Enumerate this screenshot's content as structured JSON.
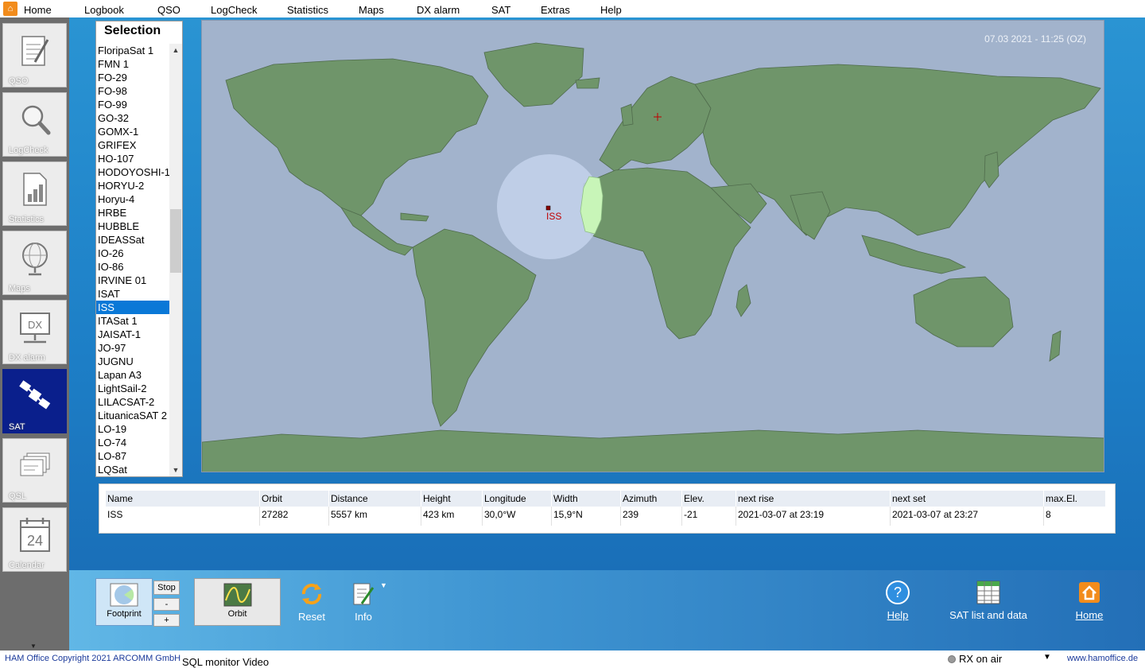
{
  "menu": {
    "items": [
      "Home",
      "Logbook",
      "QSO",
      "LogCheck",
      "Statistics",
      "Maps",
      "DX alarm",
      "SAT",
      "Extras",
      "Help"
    ]
  },
  "sidebar": {
    "items": [
      {
        "label": "QSO",
        "icon": "notepad-icon"
      },
      {
        "label": "LogCheck",
        "icon": "magnifier-icon"
      },
      {
        "label": "Statistics",
        "icon": "chart-document-icon"
      },
      {
        "label": "Maps",
        "icon": "globe-icon"
      },
      {
        "label": "DX alarm",
        "icon": "dx-monitor-icon"
      },
      {
        "label": "SAT",
        "icon": "satellite-icon"
      },
      {
        "label": "QSL",
        "icon": "cards-icon"
      },
      {
        "label": "Calendar",
        "icon": "calendar-icon",
        "day": "24"
      }
    ],
    "active": "SAT"
  },
  "selection": {
    "title": "Selection",
    "items": [
      "FloripaSat 1",
      "FMN 1",
      "FO-29",
      "FO-98",
      "FO-99",
      "GO-32",
      "GOMX-1",
      "GRIFEX",
      "HO-107",
      "HODOYOSHI-1",
      "HORYU-2",
      "Horyu-4",
      "HRBE",
      "HUBBLE",
      "IDEASSat",
      "IO-26",
      "IO-86",
      "IRVINE 01",
      "ISAT",
      "ISS",
      "ITASat 1",
      "JAISAT-1",
      "JO-97",
      "JUGNU",
      "Lapan A3",
      "LightSail-2",
      "LILACSAT-2",
      "LituanicaSAT 2",
      "LO-19",
      "LO-74",
      "LO-87",
      "LQSat"
    ],
    "selected": "ISS"
  },
  "map": {
    "datetime": "07.03 2021 - 11:25 (OZ)",
    "satellite_label": "ISS",
    "ocean_color": "#a2b3cc",
    "land_color": "#6f956a",
    "footprint_color": "#c3d2ea",
    "daylight_color": "#c8f5b8"
  },
  "table": {
    "headers": [
      "Name",
      "Orbit",
      "Distance",
      "Height",
      "Longitude",
      "Width",
      "Azimuth",
      "Elev.",
      "next rise",
      "next set",
      "max.El."
    ],
    "row": [
      "ISS",
      "27282",
      "5557 km",
      "423 km",
      "30,0°W",
      "15,9°N",
      "239",
      "-21",
      "2021-03-07 at 23:19",
      "2021-03-07 at 23:27",
      "8"
    ]
  },
  "toolbar": {
    "footprint_label": "Footprint",
    "stop_label": "Stop",
    "minus_label": "-",
    "plus_label": "+",
    "orbit_label": "Orbit",
    "reset_label": "Reset",
    "info_label": "Info",
    "help_label": "Help",
    "satlist_label": "SAT list and data",
    "home_label": "Home"
  },
  "status": {
    "copyright": "HAM Office Copyright 2021 ARCOMM GmbH",
    "tabs": "SQL monitor  Video",
    "rx": "RX on air",
    "website": "www.hamoffice.de"
  }
}
